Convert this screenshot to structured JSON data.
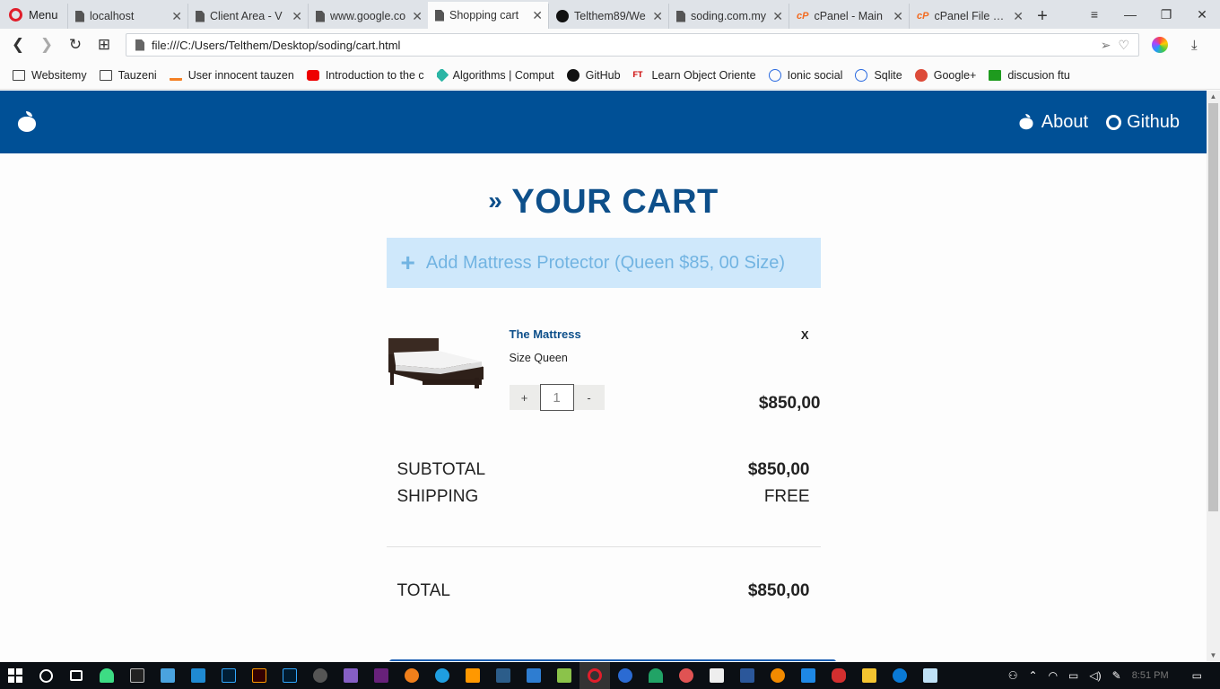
{
  "browser": {
    "menu_label": "Menu",
    "tabs": [
      {
        "title": "localhost",
        "icon": "doc-icon"
      },
      {
        "title": "Client Area - V",
        "icon": "doc-icon"
      },
      {
        "title": "www.google.co",
        "icon": "doc-icon"
      },
      {
        "title": "Shopping cart",
        "icon": "doc-icon",
        "active": true
      },
      {
        "title": "Telthem89/We",
        "icon": "github-icon"
      },
      {
        "title": "soding.com.my",
        "icon": "doc-icon"
      },
      {
        "title": "cPanel - Main",
        "icon": "cpanel-icon"
      },
      {
        "title": "cPanel File Ma",
        "icon": "cpanel-icon"
      }
    ],
    "url": "file:///C:/Users/Telthem/Desktop/soding/cart.html",
    "bookmarks": [
      {
        "label": "Websitemy",
        "icon": "folder-icon"
      },
      {
        "label": "Tauzeni",
        "icon": "folder-icon"
      },
      {
        "label": "User innocent tauzen",
        "icon": "stackoverflow-icon"
      },
      {
        "label": "Introduction to the c",
        "icon": "youtube-icon"
      },
      {
        "label": "Algorithms | Comput",
        "icon": "algorithms-icon"
      },
      {
        "label": "GitHub",
        "icon": "github-icon"
      },
      {
        "label": "Learn Object Oriente",
        "icon": "ft-icon"
      },
      {
        "label": "Ionic social",
        "icon": "ionic-icon"
      },
      {
        "label": "Sqlite",
        "icon": "sqlite-icon"
      },
      {
        "label": "Google+",
        "icon": "googleplus-icon"
      },
      {
        "label": "discusion ftu",
        "icon": "ftu-icon"
      }
    ]
  },
  "site": {
    "nav": {
      "about": "About",
      "github": "Github"
    },
    "brand_color": "#005096",
    "accent_color": "#0d4f8a"
  },
  "cart": {
    "title_prefix": "»",
    "title": "YOUR CART",
    "protector_label": "Add Mattress Protector (Queen $85, 00 Size)",
    "item": {
      "name": "The Mattress",
      "size": "Size Queen",
      "quantity": "1",
      "increment": "+",
      "decrement": "-",
      "remove": "X",
      "price": "$850,00"
    },
    "summary": {
      "subtotal_label": "SUBTOTAL",
      "subtotal_value": "$850,00",
      "shipping_label": "SHIPPING",
      "shipping_value": "FREE",
      "total_label": "TOTAL",
      "total_value": "$850,00"
    }
  },
  "taskbar": {
    "clock": "8:51 PM"
  }
}
